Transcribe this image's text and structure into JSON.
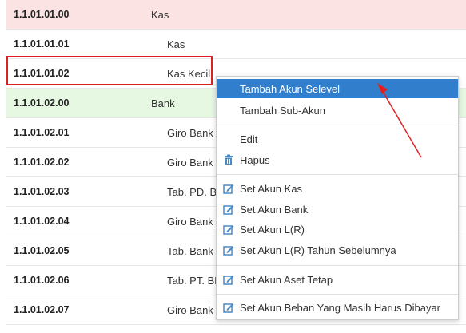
{
  "rows": [
    {
      "code": "1.1.01.01.00",
      "name": "Kas",
      "level": 1,
      "style": "pink"
    },
    {
      "code": "1.1.01.01.01",
      "name": "Kas",
      "level": 2,
      "style": ""
    },
    {
      "code": "1.1.01.01.02",
      "name": "Kas Kecil",
      "level": 2,
      "style": ""
    },
    {
      "code": "1.1.01.02.00",
      "name": "Bank",
      "level": 1,
      "style": "green"
    },
    {
      "code": "1.1.01.02.01",
      "name": "Giro Bank",
      "level": 2,
      "style": ""
    },
    {
      "code": "1.1.01.02.02",
      "name": "Giro Bank",
      "level": 2,
      "style": ""
    },
    {
      "code": "1.1.01.02.03",
      "name": "Tab. PD. Bl",
      "level": 2,
      "style": ""
    },
    {
      "code": "1.1.01.02.04",
      "name": "Giro Bank",
      "level": 2,
      "style": ""
    },
    {
      "code": "1.1.01.02.05",
      "name": "Tab. Bank",
      "level": 2,
      "style": ""
    },
    {
      "code": "1.1.01.02.06",
      "name": "Tab. PT. BF",
      "level": 2,
      "style": ""
    },
    {
      "code": "1.1.01.02.07",
      "name": "Giro Bank",
      "level": 2,
      "style": ""
    }
  ],
  "context_menu": {
    "items": {
      "add_same_level": "Tambah Akun Selevel",
      "add_sub": "Tambah Sub-Akun",
      "edit": "Edit",
      "delete": "Hapus",
      "set_cash": "Set Akun Kas",
      "set_bank": "Set Akun Bank",
      "set_pl": "Set Akun L(R)",
      "set_pl_prev": "Set Akun L(R) Tahun Sebelumnya",
      "set_fixed_asset": "Set Akun Aset Tetap",
      "set_accrued": "Set Akun Beban Yang Masih Harus Dibayar"
    },
    "icons": {
      "delete": "trash-icon",
      "set": "edit-icon"
    }
  },
  "colors": {
    "row_pink": "#fbe3e4",
    "row_green": "#e6f7e2",
    "menu_active": "#307ecc",
    "annotation_red": "#e02020",
    "icon_blue": "#4a8ac6"
  }
}
